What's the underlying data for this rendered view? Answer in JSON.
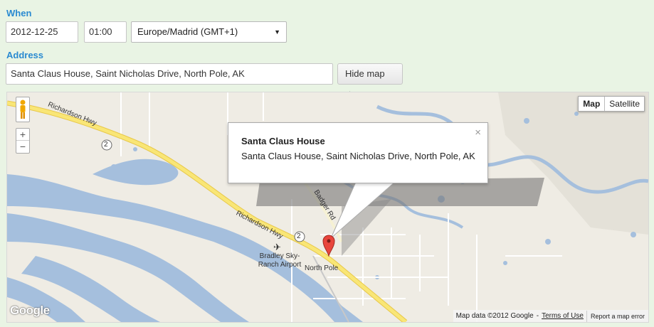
{
  "form": {
    "when_label": "When",
    "date_value": "2012-12-25",
    "time_value": "01:00",
    "timezone_value": "Europe/Madrid (GMT+1)",
    "address_label": "Address",
    "address_value": "Santa Claus House, Saint Nicholas Drive, North Pole, AK",
    "hide_map_label": "Hide map ▲"
  },
  "map": {
    "type_map": "Map",
    "type_satellite": "Satellite",
    "zoom_in": "+",
    "zoom_out": "−",
    "infowindow_title": "Santa Claus House",
    "infowindow_address": "Santa Claus House, Saint Nicholas Drive, North Pole, AK",
    "close_glyph": "×",
    "labels": {
      "richardson_hwy_1": "Richardson Hwy",
      "richardson_hwy_2": "Richardson Hwy",
      "badger_rd": "Badger Rd",
      "route_2a": "2",
      "route_2b": "2",
      "airport": "Bradley Sky-Ranch Airport",
      "north_pole": "North Pole"
    },
    "logo": "Google",
    "attribution": "Map data ©2012 Google",
    "terms": "Terms of Use",
    "report": "Report a map error",
    "colors": {
      "water": "#a5bfdd",
      "land": "#efece4",
      "highway": "#f9e676",
      "road": "#ffffff",
      "marker": "#e8453c"
    }
  }
}
